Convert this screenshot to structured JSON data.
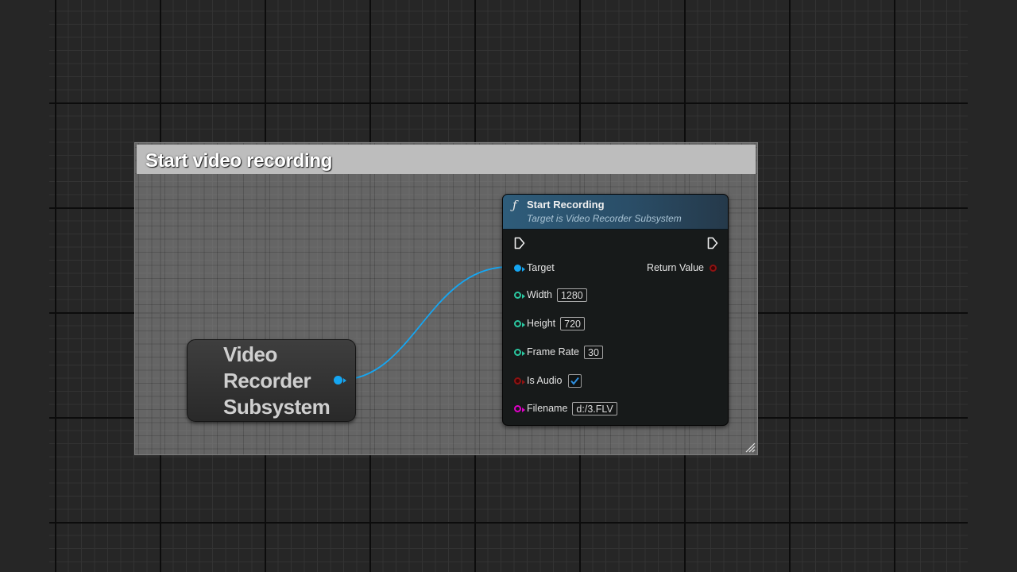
{
  "comment": {
    "title": "Start video recording"
  },
  "variable_node": {
    "title_lines": [
      "Video",
      "Recorder",
      "Subsystem"
    ]
  },
  "function_node": {
    "icon": "function-icon",
    "title": "Start Recording",
    "subtitle": "Target is Video Recorder Subsystem",
    "pins": {
      "target": {
        "label": "Target"
      },
      "width": {
        "label": "Width",
        "value": "1280"
      },
      "height": {
        "label": "Height",
        "value": "720"
      },
      "frame_rate": {
        "label": "Frame Rate",
        "value": "30"
      },
      "is_audio": {
        "label": "Is Audio",
        "checked": true
      },
      "filename": {
        "label": "Filename",
        "value": "d:/3.FLV"
      },
      "return_value": {
        "label": "Return Value"
      }
    }
  },
  "colors": {
    "object_pin": "#15a6f2",
    "int_pin": "#2bc7a0",
    "bool_pin": "#8e1212",
    "string_pin": "#e000c8",
    "function_header": "#2e5c7a"
  }
}
